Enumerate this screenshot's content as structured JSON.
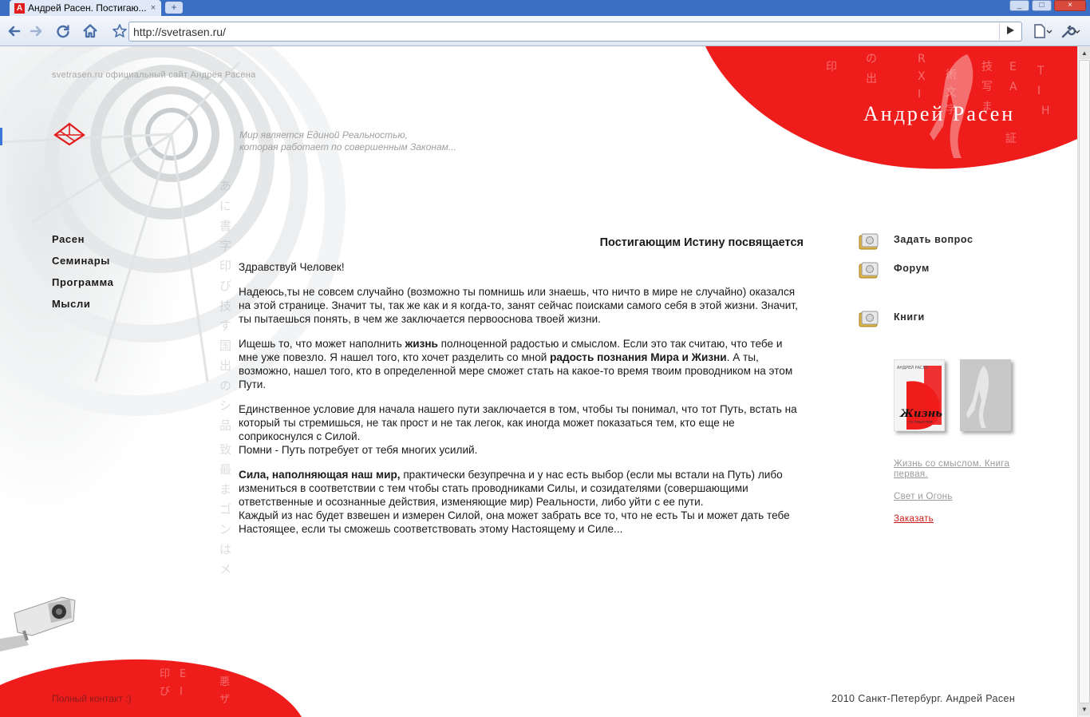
{
  "browser": {
    "tab_title": "Андрей Расен. Постигаю...",
    "tab_close": "×",
    "new_tab": "+",
    "url": "http://svetrasen.ru/",
    "window_buttons": [
      "_",
      "□",
      "×"
    ]
  },
  "header": {
    "site_tagline": "svetrasen.ru официальный сайт Андрея Расена",
    "motto_line1": "Мир является Единой Реальностью,",
    "motto_line2": "которая работает по совершенным Законам...",
    "brand_name": "Андрей Расен"
  },
  "left_nav": [
    "Расен",
    "Семинары",
    "Программа",
    "Мысли"
  ],
  "article": {
    "title": "Постигающим Истину посвящается",
    "greeting": "Здравствуй Человек!",
    "p1": "Надеюсь,ты не совсем случайно (возможно ты помнишь или знаешь, что ничто в мире не случайно) оказался на этой странице. Значит ты, так же как и я когда-то, занят сейчас поисками самого себя в этой жизни. Значит, ты пытаешься понять, в чем же заключается первооснова твоей жизни.",
    "p2_a": "Ищешь то, что может наполнить ",
    "p2_b": "жизнь",
    "p2_c": " полноценной радостью и смыслом. Если это так считаю, что тебе и мне уже повезло. Я нашел того, кто хочет разделить со мной ",
    "p2_d": "радость познания Мира и Жизни",
    "p2_e": ". А ты, возможно, нашел того, кто в определенной мере сможет стать на какое-то время твоим проводником на этом Пути.",
    "p3": "Единственное условие для начала нашего пути заключается в том, чтобы ты  понимал, что тот Путь, встать на который ты стремишься, не так прост и не так легок, как иногда может показаться тем, кто еще не соприкоснулся с Силой.",
    "p3_b": "Помни - Путь потребует от тебя многих усилий.",
    "p4_a": "Сила, наполняющая наш мир,",
    "p4_b": " практически безупречна и у нас есть выбор (если мы встали на Путь) либо измениться в соответствии с тем чтобы стать проводниками Силы, и созидателями (совершающими ответственные и осознанные действия, изменяющие мир) Реальности, либо уйти с ее пути.",
    "p4_c": "Каждый из нас будет взвешен и измерен Силой, она может забрать все то, что не есть Ты и может дать тебе Настоящее, если ты сможешь соответствовать этому Настоящему и Силе..."
  },
  "right_nav": [
    "Задать вопрос",
    "Форум",
    "Книги"
  ],
  "books": {
    "cover_title": "Жизнь",
    "cover_subtitle": "со смыслом",
    "cover_author": "АНДРЕЙ РАСЕН",
    "link1": "Жизнь со смыслом. Книга первая.",
    "link2": "Свет и Огонь",
    "order": "Заказать"
  },
  "footer": {
    "text": "2010 Санкт-Петербург. Андрей Расен",
    "left": "Полный контакт :)"
  },
  "colors": {
    "accent_red": "#ef1c1c",
    "text": "#1a1a1a",
    "muted": "#a0a0a0"
  }
}
